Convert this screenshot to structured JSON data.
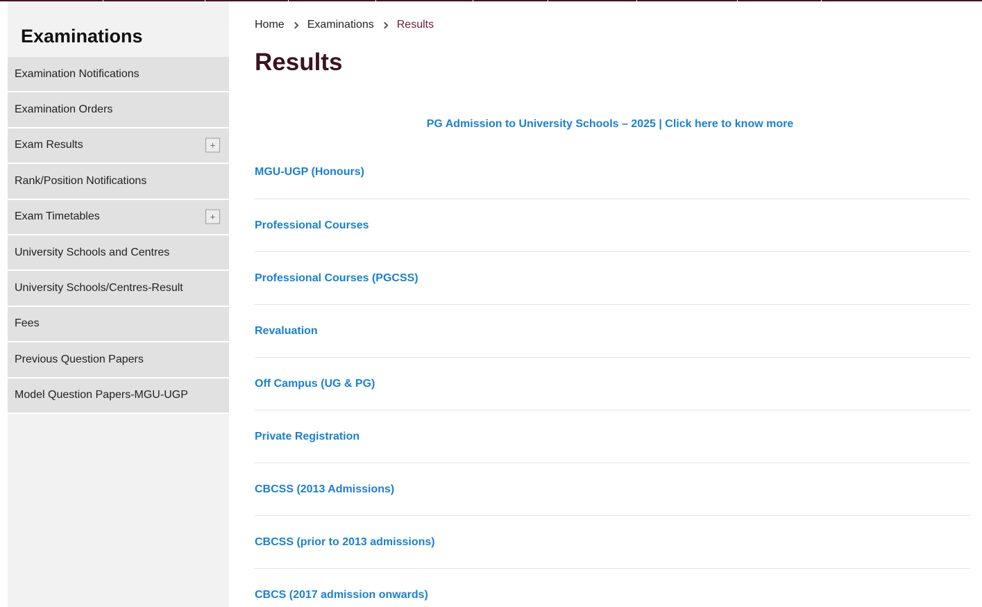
{
  "colors": {
    "brand": "#4a1020",
    "title": "#3a1420",
    "breadcrumb_current": "#6b1a3a",
    "link": "#1a7fd4",
    "sidebar_bg": "#f2f2f2",
    "sidebar_item_bg": "#e1e1e1"
  },
  "sidebar": {
    "title": "Examinations",
    "items": [
      {
        "label": "Examination Notifications",
        "expandable": false
      },
      {
        "label": "Examination Orders",
        "expandable": false
      },
      {
        "label": "Exam Results",
        "expandable": true,
        "expander_symbol": "+"
      },
      {
        "label": "Rank/Position Notifications",
        "expandable": false
      },
      {
        "label": "Exam Timetables",
        "expandable": true,
        "expander_symbol": "+"
      },
      {
        "label": "University Schools and Centres",
        "expandable": false
      },
      {
        "label": "University Schools/Centres-Result",
        "expandable": false
      },
      {
        "label": "Fees",
        "expandable": false
      },
      {
        "label": "Previous Question Papers",
        "expandable": false
      },
      {
        "label": "Model Question Papers-MGU-UGP",
        "expandable": false
      }
    ]
  },
  "breadcrumb": {
    "items": [
      "Home",
      "Examinations"
    ],
    "current": "Results",
    "separator_icon": "chevron-right-icon"
  },
  "main": {
    "title": "Results",
    "banner_link": "PG Admission to University Schools – 2025 | Click here to know more",
    "results": [
      "MGU-UGP (Honours)",
      "Professional Courses",
      "Professional Courses (PGCSS)",
      "Revaluation",
      "Off Campus (UG & PG)",
      "Private Registration",
      "CBCSS (2013 Admissions)",
      "CBCSS (prior to 2013 admissions)",
      "CBCS (2017 admission onwards)"
    ]
  }
}
